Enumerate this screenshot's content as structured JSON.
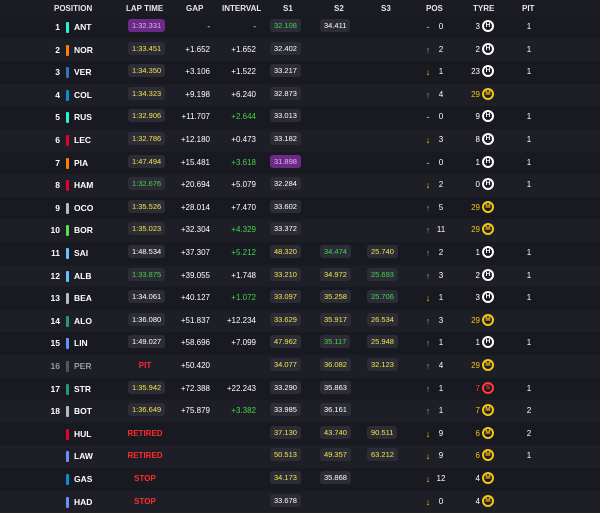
{
  "headers": {
    "position": "POSITION",
    "lap_time": "LAP TIME",
    "gap": "GAP",
    "interval": "INTERVAL",
    "s1": "S1",
    "s2": "S2",
    "s3": "S3",
    "pos": "POS",
    "tyre": "TYRE",
    "pit": "PIT"
  },
  "colors": {
    "background": "#15151e",
    "purple": "#6a2a86",
    "green": "#46d34a",
    "yellow": "#f5c518",
    "red": "#ff2b2b"
  },
  "rows": [
    {
      "pos": "1",
      "driver": "ANT",
      "team_color": "#27f4d2",
      "lap": "1:32.331",
      "lap_style": "purple",
      "gap": "-",
      "interval": "-",
      "int_style": "",
      "s1": "32.108",
      "s1_style": "grn",
      "s2": "34.411",
      "s2_style": "",
      "s3": "",
      "s3_style": "",
      "arrow": "-",
      "arrow_style": "same",
      "pos_change": "0",
      "tyre_age": "3",
      "age_style": "",
      "tyre": "H",
      "pit": "1",
      "dim": false,
      "status": ""
    },
    {
      "pos": "2",
      "driver": "NOR",
      "team_color": "#ff8000",
      "lap": "1:33.451",
      "lap_style": "yel",
      "gap": "+1.652",
      "interval": "+1.652",
      "int_style": "",
      "s1": "32.402",
      "s1_style": "",
      "s2": "",
      "s2_style": "",
      "s3": "",
      "s3_style": "",
      "arrow": "↑",
      "arrow_style": "up",
      "pos_change": "2",
      "tyre_age": "2",
      "age_style": "",
      "tyre": "H",
      "pit": "1",
      "dim": false,
      "status": ""
    },
    {
      "pos": "3",
      "driver": "VER",
      "team_color": "#3671c6",
      "lap": "1:34.350",
      "lap_style": "yel",
      "gap": "+3.106",
      "interval": "+1.522",
      "int_style": "",
      "s1": "33.217",
      "s1_style": "",
      "s2": "",
      "s2_style": "",
      "s3": "",
      "s3_style": "",
      "arrow": "↓",
      "arrow_style": "down",
      "pos_change": "1",
      "tyre_age": "23",
      "age_style": "",
      "tyre": "H",
      "pit": "1",
      "dim": false,
      "status": ""
    },
    {
      "pos": "4",
      "driver": "COL",
      "team_color": "#0093cc",
      "lap": "1:34.323",
      "lap_style": "yel",
      "gap": "+9.198",
      "interval": "+6.240",
      "int_style": "",
      "s1": "32.873",
      "s1_style": "",
      "s2": "",
      "s2_style": "",
      "s3": "",
      "s3_style": "",
      "arrow": "↑",
      "arrow_style": "up",
      "pos_change": "4",
      "tyre_age": "29",
      "age_style": "yel",
      "tyre": "M",
      "pit": "",
      "dim": false,
      "status": ""
    },
    {
      "pos": "5",
      "driver": "RUS",
      "team_color": "#27f4d2",
      "lap": "1:32.906",
      "lap_style": "yel",
      "gap": "+11.707",
      "interval": "+2.644",
      "int_style": "grn",
      "s1": "33.013",
      "s1_style": "",
      "s2": "",
      "s2_style": "",
      "s3": "",
      "s3_style": "",
      "arrow": "-",
      "arrow_style": "same",
      "pos_change": "0",
      "tyre_age": "9",
      "age_style": "",
      "tyre": "H",
      "pit": "1",
      "dim": false,
      "status": ""
    },
    {
      "pos": "6",
      "driver": "LEC",
      "team_color": "#e8002d",
      "lap": "1:32.786",
      "lap_style": "yel",
      "gap": "+12.180",
      "interval": "+0.473",
      "int_style": "",
      "s1": "33.182",
      "s1_style": "",
      "s2": "",
      "s2_style": "",
      "s3": "",
      "s3_style": "",
      "arrow": "↓",
      "arrow_style": "down",
      "pos_change": "3",
      "tyre_age": "8",
      "age_style": "",
      "tyre": "H",
      "pit": "1",
      "dim": false,
      "status": ""
    },
    {
      "pos": "7",
      "driver": "PIA",
      "team_color": "#ff8000",
      "lap": "1:47.494",
      "lap_style": "yel",
      "gap": "+15.481",
      "interval": "+3.618",
      "int_style": "grn",
      "s1": "31.898",
      "s1_style": "purple",
      "s2": "",
      "s2_style": "",
      "s3": "",
      "s3_style": "",
      "arrow": "-",
      "arrow_style": "same",
      "pos_change": "0",
      "tyre_age": "1",
      "age_style": "",
      "tyre": "H",
      "pit": "1",
      "dim": false,
      "status": ""
    },
    {
      "pos": "8",
      "driver": "HAM",
      "team_color": "#e8002d",
      "lap": "1:32.676",
      "lap_style": "grn",
      "gap": "+20.694",
      "interval": "+5.079",
      "int_style": "",
      "s1": "32.284",
      "s1_style": "",
      "s2": "",
      "s2_style": "",
      "s3": "",
      "s3_style": "",
      "arrow": "↓",
      "arrow_style": "down",
      "pos_change": "2",
      "tyre_age": "0",
      "age_style": "",
      "tyre": "H",
      "pit": "1",
      "dim": false,
      "status": ""
    },
    {
      "pos": "9",
      "driver": "OCO",
      "team_color": "#b6babd",
      "lap": "1:35.526",
      "lap_style": "yel",
      "gap": "+28.014",
      "interval": "+7.470",
      "int_style": "",
      "s1": "33.602",
      "s1_style": "",
      "s2": "",
      "s2_style": "",
      "s3": "",
      "s3_style": "",
      "arrow": "↑",
      "arrow_style": "up",
      "pos_change": "5",
      "tyre_age": "29",
      "age_style": "yel",
      "tyre": "M",
      "pit": "",
      "dim": false,
      "status": ""
    },
    {
      "pos": "10",
      "driver": "BOR",
      "team_color": "#52e252",
      "lap": "1:35.023",
      "lap_style": "yel",
      "gap": "+32.304",
      "interval": "+4.329",
      "int_style": "grn",
      "s1": "33.372",
      "s1_style": "",
      "s2": "",
      "s2_style": "",
      "s3": "",
      "s3_style": "",
      "arrow": "↑",
      "arrow_style": "up",
      "pos_change": "11",
      "tyre_age": "29",
      "age_style": "yel",
      "tyre": "M",
      "pit": "",
      "dim": false,
      "status": ""
    },
    {
      "pos": "11",
      "driver": "SAI",
      "team_color": "#64c4ff",
      "lap": "1:48.534",
      "lap_style": "",
      "gap": "+37.307",
      "interval": "+5.212",
      "int_style": "grn",
      "s1": "48.320",
      "s1_style": "yel",
      "s2": "34.474",
      "s2_style": "grn",
      "s3": "25.740",
      "s3_style": "yel",
      "arrow": "↑",
      "arrow_style": "up",
      "pos_change": "2",
      "tyre_age": "1",
      "age_style": "",
      "tyre": "H",
      "pit": "1",
      "dim": false,
      "status": ""
    },
    {
      "pos": "12",
      "driver": "ALB",
      "team_color": "#64c4ff",
      "lap": "1:33.875",
      "lap_style": "grn",
      "gap": "+39.055",
      "interval": "+1.748",
      "int_style": "",
      "s1": "33.210",
      "s1_style": "yel",
      "s2": "34.972",
      "s2_style": "yel",
      "s3": "25.693",
      "s3_style": "grn",
      "arrow": "↑",
      "arrow_style": "up",
      "pos_change": "3",
      "tyre_age": "2",
      "age_style": "",
      "tyre": "H",
      "pit": "1",
      "dim": false,
      "status": ""
    },
    {
      "pos": "13",
      "driver": "BEA",
      "team_color": "#b6babd",
      "lap": "1:34.061",
      "lap_style": "",
      "gap": "+40.127",
      "interval": "+1.072",
      "int_style": "grn",
      "s1": "33.097",
      "s1_style": "yel",
      "s2": "35.258",
      "s2_style": "yel",
      "s3": "25.706",
      "s3_style": "grn",
      "arrow": "↓",
      "arrow_style": "down",
      "pos_change": "1",
      "tyre_age": "3",
      "age_style": "",
      "tyre": "H",
      "pit": "1",
      "dim": false,
      "status": ""
    },
    {
      "pos": "14",
      "driver": "ALO",
      "team_color": "#229971",
      "lap": "1:36.080",
      "lap_style": "",
      "gap": "+51.837",
      "interval": "+12.234",
      "int_style": "",
      "s1": "33.629",
      "s1_style": "yel",
      "s2": "35.917",
      "s2_style": "yel",
      "s3": "26.534",
      "s3_style": "yel",
      "arrow": "↑",
      "arrow_style": "up",
      "pos_change": "3",
      "tyre_age": "29",
      "age_style": "yel",
      "tyre": "M",
      "pit": "",
      "dim": false,
      "status": ""
    },
    {
      "pos": "15",
      "driver": "LIN",
      "team_color": "#6692ff",
      "lap": "1:49.027",
      "lap_style": "",
      "gap": "+58.696",
      "interval": "+7.099",
      "int_style": "",
      "s1": "47.962",
      "s1_style": "yel",
      "s2": "35.117",
      "s2_style": "grn",
      "s3": "25.948",
      "s3_style": "yel",
      "arrow": "↑",
      "arrow_style": "up",
      "pos_change": "1",
      "tyre_age": "1",
      "age_style": "",
      "tyre": "H",
      "pit": "1",
      "dim": false,
      "status": ""
    },
    {
      "pos": "16",
      "driver": "PER",
      "team_color": "#555560",
      "lap": "",
      "lap_style": "",
      "gap": "+50.420",
      "interval": "",
      "int_style": "",
      "s1": "34.077",
      "s1_style": "yel",
      "s2": "36.082",
      "s2_style": "yel",
      "s3": "32.123",
      "s3_style": "yel",
      "arrow": "↑",
      "arrow_style": "up",
      "pos_change": "4",
      "tyre_age": "29",
      "age_style": "yel",
      "tyre": "M",
      "pit": "",
      "dim": true,
      "status": "PIT"
    },
    {
      "pos": "17",
      "driver": "STR",
      "team_color": "#229971",
      "lap": "1:35.942",
      "lap_style": "yel",
      "gap": "+72.388",
      "interval": "+22.243",
      "int_style": "",
      "s1": "33.290",
      "s1_style": "",
      "s2": "35.863",
      "s2_style": "",
      "s3": "",
      "s3_style": "",
      "arrow": "↑",
      "arrow_style": "up",
      "pos_change": "1",
      "tyre_age": "7",
      "age_style": "red",
      "tyre": "S",
      "pit": "1",
      "dim": false,
      "status": ""
    },
    {
      "pos": "18",
      "driver": "BOT",
      "team_color": "#b6babd",
      "lap": "1:36.649",
      "lap_style": "yel",
      "gap": "+75.879",
      "interval": "+3.382",
      "int_style": "grn",
      "s1": "33.985",
      "s1_style": "",
      "s2": "36.161",
      "s2_style": "",
      "s3": "",
      "s3_style": "",
      "arrow": "↑",
      "arrow_style": "up",
      "pos_change": "1",
      "tyre_age": "7",
      "age_style": "yel",
      "tyre": "M",
      "pit": "2",
      "dim": false,
      "status": ""
    },
    {
      "pos": "",
      "driver": "HUL",
      "team_color": "#e8002d",
      "lap": "",
      "lap_style": "",
      "gap": "",
      "interval": "",
      "int_style": "",
      "s1": "37.130",
      "s1_style": "yel",
      "s2": "43.740",
      "s2_style": "yel",
      "s3": "90.511",
      "s3_style": "yel",
      "arrow": "↓",
      "arrow_style": "down",
      "pos_change": "9",
      "tyre_age": "6",
      "age_style": "yel",
      "tyre": "M",
      "pit": "2",
      "dim": false,
      "status": "RETIRED"
    },
    {
      "pos": "",
      "driver": "LAW",
      "team_color": "#6692ff",
      "lap": "",
      "lap_style": "",
      "gap": "",
      "interval": "",
      "int_style": "",
      "s1": "50.513",
      "s1_style": "yel",
      "s2": "49.357",
      "s2_style": "yel",
      "s3": "63.212",
      "s3_style": "yel",
      "arrow": "↓",
      "arrow_style": "down",
      "pos_change": "9",
      "tyre_age": "6",
      "age_style": "yel",
      "tyre": "M",
      "pit": "1",
      "dim": false,
      "status": "RETIRED"
    },
    {
      "pos": "",
      "driver": "GAS",
      "team_color": "#0093cc",
      "lap": "",
      "lap_style": "",
      "gap": "",
      "interval": "",
      "int_style": "",
      "s1": "34.173",
      "s1_style": "yel",
      "s2": "35.868",
      "s2_style": "",
      "s3": "",
      "s3_style": "",
      "arrow": "↓",
      "arrow_style": "down",
      "pos_change": "12",
      "tyre_age": "4",
      "age_style": "",
      "tyre": "M",
      "pit": "",
      "dim": false,
      "status": "STOP"
    },
    {
      "pos": "",
      "driver": "HAD",
      "team_color": "#6692ff",
      "lap": "",
      "lap_style": "",
      "gap": "",
      "interval": "",
      "int_style": "",
      "s1": "33.678",
      "s1_style": "",
      "s2": "",
      "s2_style": "",
      "s3": "",
      "s3_style": "",
      "arrow": "↓",
      "arrow_style": "down",
      "pos_change": "0",
      "tyre_age": "4",
      "age_style": "",
      "tyre": "M",
      "pit": "",
      "dim": false,
      "status": "STOP"
    }
  ]
}
